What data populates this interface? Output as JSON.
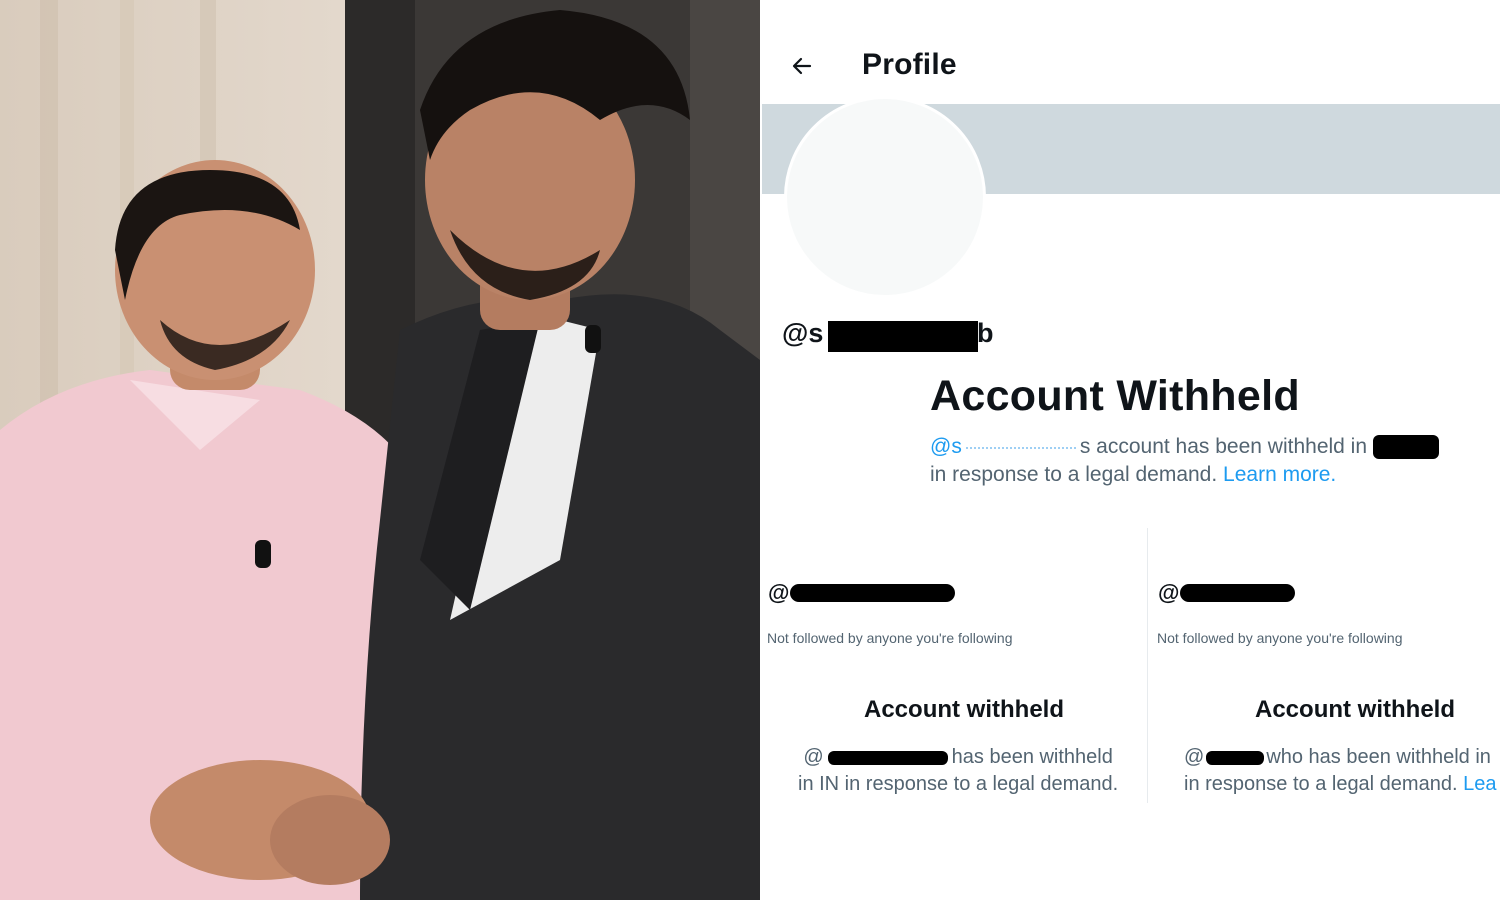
{
  "header": {
    "title": "Profile",
    "back_icon": "arrow-left-icon"
  },
  "profile": {
    "handle_prefix": "@s",
    "handle_suffix": "b",
    "withheld_title": "Account Withheld",
    "withheld_mention": "@s",
    "withheld_text_1": "s account has been withheld in",
    "withheld_text_2": "in response to a legal demand.",
    "learn_more": "Learn more."
  },
  "cards": [
    {
      "handle_prefix": "@",
      "not_followed": "Not followed by anyone you're following",
      "withheld_title": "Account withheld",
      "line1_prefix": "@",
      "line1_suffix": "has been withheld",
      "line2": "in IN in response to a legal demand.",
      "line2_link": ""
    },
    {
      "handle_prefix": "@",
      "not_followed": "Not followed by anyone you're following",
      "withheld_title": "Account withheld",
      "line1_prefix": "@",
      "line1_suffix": "who has been withheld in",
      "line2": "in response to a legal demand.",
      "line2_link": "Lea"
    }
  ],
  "colors": {
    "banner": "#cfd9de",
    "link": "#1d9bf0",
    "secondary_text": "#536471",
    "primary_text": "#0f1419"
  }
}
